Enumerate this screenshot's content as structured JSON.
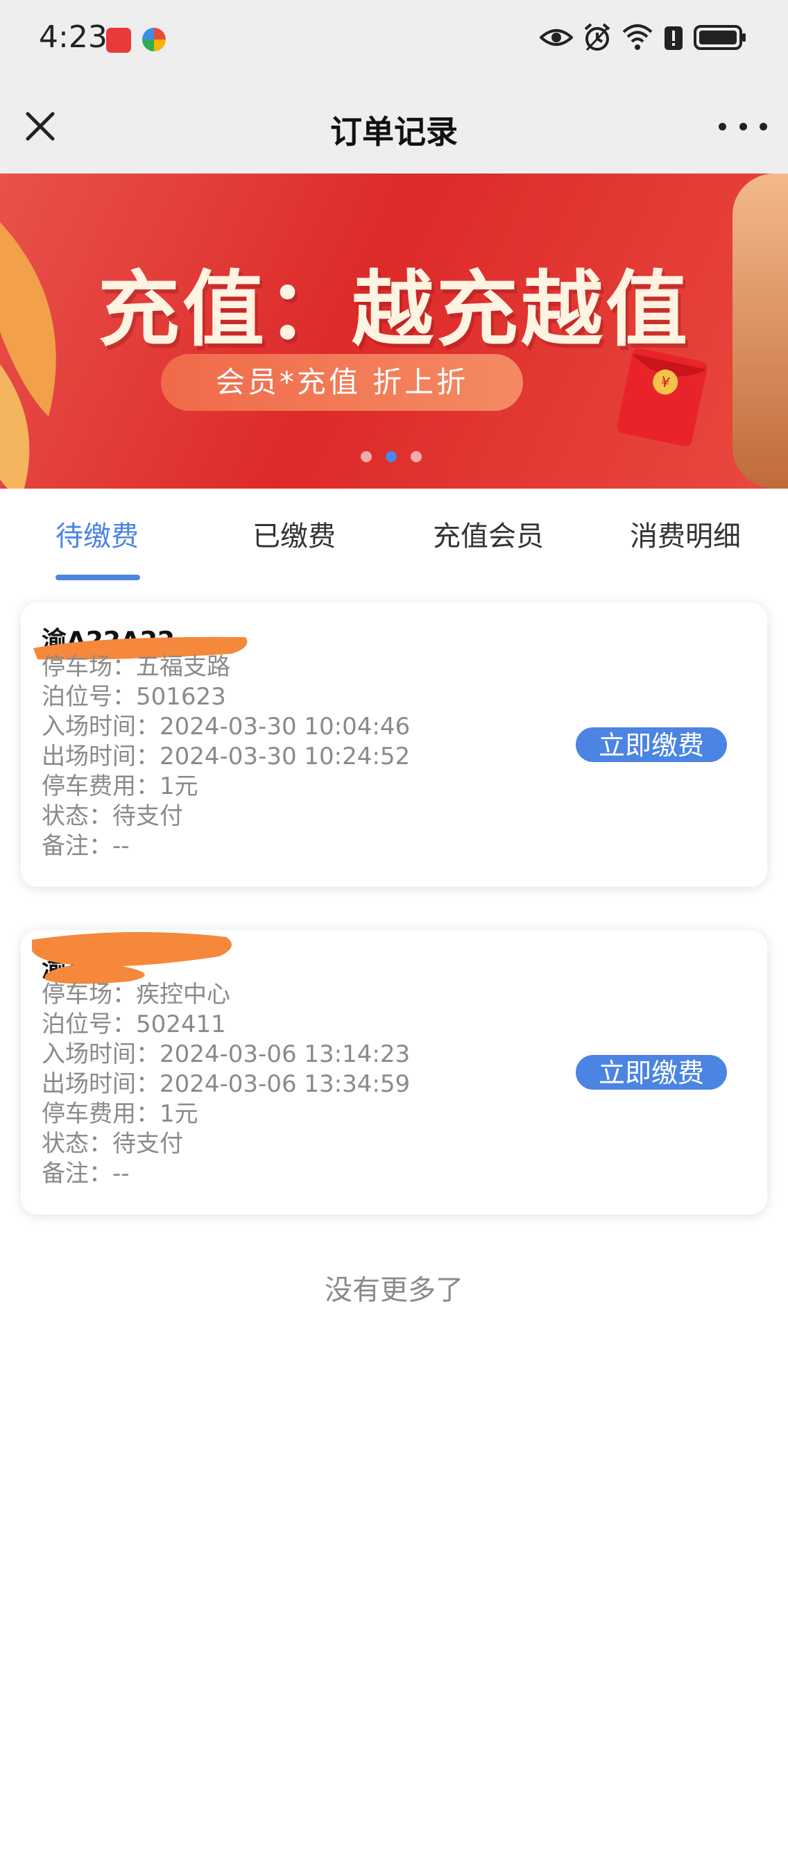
{
  "status_bar": {
    "time": "4:23",
    "icons": [
      "huawei-app-icon",
      "browser-app-icon",
      "eye-icon",
      "alarm-icon",
      "wifi-icon",
      "alert-icon",
      "battery-icon"
    ]
  },
  "nav": {
    "title": "订单记录",
    "close_icon": "close-icon",
    "more_icon": "more-icon"
  },
  "banner": {
    "title": "充值：越充越值",
    "subtitle": "会员*充值 折上折",
    "active_dot": 1,
    "dot_count": 3,
    "colors": {
      "background": "#dd2a2a",
      "title": "#fff3e2"
    }
  },
  "tabs": [
    {
      "label": "待缴费",
      "active": true
    },
    {
      "label": "已缴费",
      "active": false
    },
    {
      "label": "充值会员",
      "active": false
    },
    {
      "label": "消费明细",
      "active": false
    }
  ],
  "orders": [
    {
      "plate": "渝A22A22",
      "fields": [
        "停车场：五福支路",
        "泊位号：501623",
        "入场时间：2024-03-30 10:04:46",
        "出场时间：2024-03-30 10:24:52",
        "停车费用：1元",
        "状态：待支付",
        "备注：--"
      ],
      "button": "立即缴费"
    },
    {
      "plate": "渝A22",
      "fields": [
        "停车场：疾控中心",
        "泊位号：502411",
        "入场时间：2024-03-06 13:14:23",
        "出场时间：2024-03-06 13:34:59",
        "停车费用：1元",
        "状态：待支付",
        "备注：--"
      ],
      "button": "立即缴费"
    }
  ],
  "footer": {
    "no_more": "没有更多了"
  },
  "colors": {
    "accent": "#4b84e2",
    "redaction": "#f5883a",
    "muted_text": "#8a8a8a"
  }
}
